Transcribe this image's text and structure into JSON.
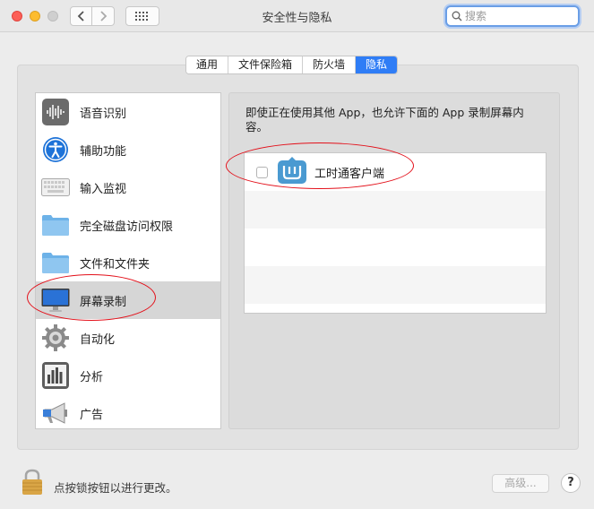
{
  "window": {
    "title": "安全性与隐私",
    "search_placeholder": "搜索"
  },
  "tabs": [
    {
      "label": "通用",
      "active": false
    },
    {
      "label": "文件保险箱",
      "active": false
    },
    {
      "label": "防火墙",
      "active": false
    },
    {
      "label": "隐私",
      "active": true
    }
  ],
  "sidebar": {
    "items": [
      {
        "label": "语音识别",
        "icon": "waveform-icon"
      },
      {
        "label": "辅助功能",
        "icon": "accessibility-icon"
      },
      {
        "label": "输入监视",
        "icon": "keyboard-icon"
      },
      {
        "label": "完全磁盘访问权限",
        "icon": "folder-icon"
      },
      {
        "label": "文件和文件夹",
        "icon": "folder-icon"
      },
      {
        "label": "屏幕录制",
        "icon": "display-icon",
        "selected": true
      },
      {
        "label": "自动化",
        "icon": "gear-icon"
      },
      {
        "label": "分析",
        "icon": "analytics-icon"
      },
      {
        "label": "广告",
        "icon": "megaphone-icon"
      }
    ]
  },
  "main": {
    "description": "即使正在使用其他 App，也允许下面的 App 录制屏幕内容。",
    "apps": [
      {
        "label": "工时通客户端",
        "checked": false
      }
    ]
  },
  "footer": {
    "lock_text": "点按锁按钮以进行更改。",
    "advanced_label": "高级...",
    "help_label": "?"
  },
  "colors": {
    "accent": "#2f7df6",
    "annotation": "#e3101a"
  }
}
